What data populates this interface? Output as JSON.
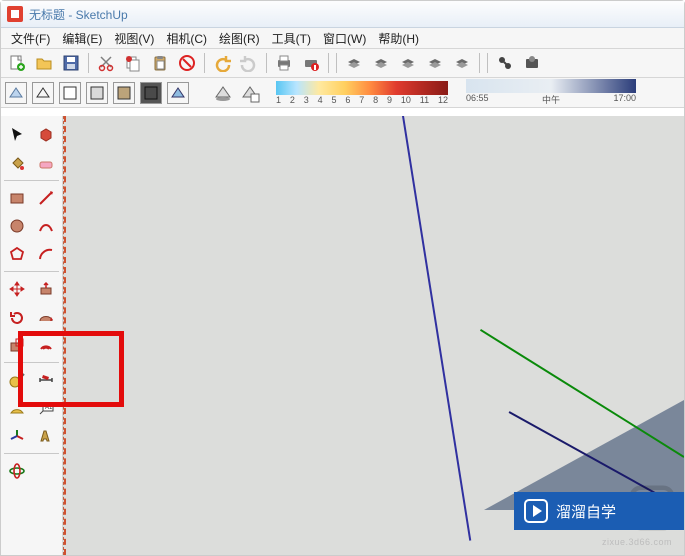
{
  "window": {
    "title": "无标题 - SketchUp"
  },
  "menu": {
    "file": "文件(F)",
    "edit": "编辑(E)",
    "view": "视图(V)",
    "camera": "相机(C)",
    "draw": "绘图(R)",
    "tools": "工具(T)",
    "window": "窗口(W)",
    "help": "帮助(H)"
  },
  "month_scale": {
    "1": "1",
    "2": "2",
    "3": "3",
    "4": "4",
    "5": "5",
    "6": "6",
    "7": "7",
    "8": "8",
    "9": "9",
    "10": "10",
    "11": "11",
    "12": "12"
  },
  "shadow_scale": {
    "start": "06:55",
    "mid": "中午",
    "end": "17:00"
  },
  "watermark": {
    "brand": "溜溜自学",
    "url": "zixue.3d66.com"
  }
}
